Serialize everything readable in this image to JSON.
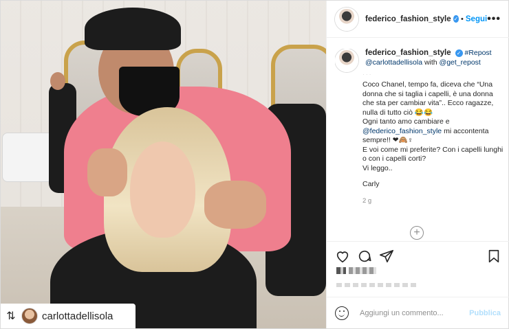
{
  "post": {
    "author": "federico_fashion_style",
    "follow_label": "Segui",
    "dot": "•",
    "more": "•••",
    "verified_mark": "✓"
  },
  "repost_badge": {
    "icon": "repost-icon",
    "username": "carlottadellisola"
  },
  "caption": {
    "author": "federico_fashion_style",
    "hashtag": "#Repost",
    "mention": "@carlottadellisola",
    "with": " with ",
    "mention2": "@get_repost",
    "line_partial": "·  ·  ·",
    "body": "Coco Chanel, tempo fa, diceva che “Una donna che si taglia i capelli, è una donna che sta per cambiar vita”.. Ecco ragazze, nulla di tutto ciò 😂😂\nOgni tanto amo cambiare e",
    "mention3": "@federico_fashion_style",
    "body2": " mi accontenta sempre!! ❤🙈♀\nE voi come mi preferite? Con i capelli lunghi o con i capelli corti?\nVi leggo..",
    "signature": "Carly",
    "time": "2 g"
  },
  "load_more": "+",
  "actions": {
    "like": "heart-icon",
    "comment": "comment-icon",
    "share": "share-icon",
    "save": "bookmark-icon"
  },
  "comment_box": {
    "placeholder": "Aggiungi un commento...",
    "publish": "Pubblica"
  }
}
